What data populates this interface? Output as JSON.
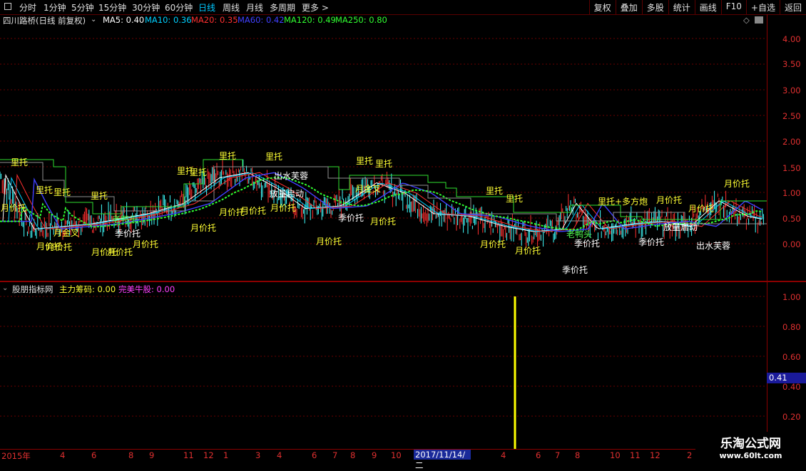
{
  "toolbar": {
    "tabs": [
      "分时",
      "1分钟",
      "5分钟",
      "15分钟",
      "30分钟",
      "60分钟",
      "日线",
      "周线",
      "月线",
      "多周期",
      "更多 >"
    ],
    "active_tab": "日线",
    "right_buttons": [
      "复权",
      "叠加",
      "多股",
      "统计",
      "画线",
      "F10",
      "+自选",
      "返回"
    ]
  },
  "main_chart": {
    "title": "四川路桥(日线 前复权)",
    "indicators": [
      {
        "label": "MA5: 0.40",
        "color": "#ffffff"
      },
      {
        "label": "MA10: 0.36",
        "color": "#00d0ff"
      },
      {
        "label": "MA20: 0.35",
        "color": "#ff3030"
      },
      {
        "label": "MA60: 0.42",
        "color": "#4040ff"
      },
      {
        "label": "MA120: 0.49",
        "color": "#30ff30"
      },
      {
        "label": "MA250: 0.80",
        "color": "#30ff30"
      }
    ],
    "y_ticks": [
      "4.00",
      "3.50",
      "3.00",
      "2.50",
      "2.00",
      "1.50",
      "1.00",
      "0.50",
      "0.00"
    ]
  },
  "annotations": [
    {
      "text": "里托",
      "color": "yellow"
    },
    {
      "text": "里托",
      "color": "yellow"
    },
    {
      "text": "里托",
      "color": "yellow"
    },
    {
      "text": "里托",
      "color": "yellow"
    },
    {
      "text": "里托",
      "color": "yellow"
    },
    {
      "text": "里托",
      "color": "yellow"
    },
    {
      "text": "里托",
      "color": "yellow"
    },
    {
      "text": "里托",
      "color": "yellow"
    },
    {
      "text": "里托",
      "color": "yellow"
    },
    {
      "text": "里托",
      "color": "yellow"
    },
    {
      "text": "里托",
      "color": "yellow"
    },
    {
      "text": "里托",
      "color": "yellow"
    },
    {
      "text": "里托+多方炮",
      "color": "yellow"
    },
    {
      "text": "月价托",
      "color": "yellow"
    },
    {
      "text": "月价托",
      "color": "yellow"
    },
    {
      "text": "月价托",
      "color": "yellow"
    },
    {
      "text": "月价托",
      "color": "yellow"
    },
    {
      "text": "月价托",
      "color": "yellow"
    },
    {
      "text": "月价托",
      "color": "yellow"
    },
    {
      "text": "月价托",
      "color": "yellow"
    },
    {
      "text": "月价托",
      "color": "yellow"
    },
    {
      "text": "月价托",
      "color": "yellow"
    },
    {
      "text": "月价托",
      "color": "yellow"
    },
    {
      "text": "月价托",
      "color": "yellow"
    },
    {
      "text": "月价托",
      "color": "yellow"
    },
    {
      "text": "月价托",
      "color": "yellow"
    },
    {
      "text": "月价托",
      "color": "yellow"
    },
    {
      "text": "月价托",
      "color": "yellow"
    },
    {
      "text": "月价托",
      "color": "yellow"
    },
    {
      "text": "月价托",
      "color": "yellow"
    },
    {
      "text": "季价托",
      "color": "white"
    },
    {
      "text": "季价托",
      "color": "white"
    },
    {
      "text": "季价托",
      "color": "white"
    },
    {
      "text": "季价托",
      "color": "white"
    },
    {
      "text": "季价托",
      "color": "white"
    },
    {
      "text": "出水芙蓉",
      "color": "white"
    },
    {
      "text": "出水芙蓉",
      "color": "white"
    },
    {
      "text": "放量启动",
      "color": "white"
    },
    {
      "text": "放量启动",
      "color": "white"
    },
    {
      "text": "老鸭头",
      "color": "green"
    },
    {
      "text": "老鸭头",
      "color": "green"
    },
    {
      "text": "月金叉",
      "color": "yellow"
    },
    {
      "text": "月金叉",
      "color": "yellow"
    }
  ],
  "sub_chart": {
    "title": "股朋指标网",
    "fields": [
      {
        "label": "主力筹码: 0.00",
        "color": "#ffff33"
      },
      {
        "label": "完美牛股: 0.00",
        "color": "#ff40ff"
      }
    ],
    "y_ticks": [
      "1.00",
      "0.80",
      "0.60",
      "0.40",
      "0.20"
    ],
    "current_value": "0.41"
  },
  "x_axis": {
    "labels": [
      "2015年",
      "4",
      "6",
      "8",
      "9",
      "11",
      "12",
      "1",
      "3",
      "4",
      "6",
      "7",
      "8",
      "9",
      "10",
      "4",
      "6",
      "7",
      "8",
      "10",
      "11",
      "12",
      "2"
    ],
    "highlight": "2017/11/14/二"
  },
  "watermark": {
    "line1": "乐淘公式网",
    "line2": "www.60lt.com"
  }
}
